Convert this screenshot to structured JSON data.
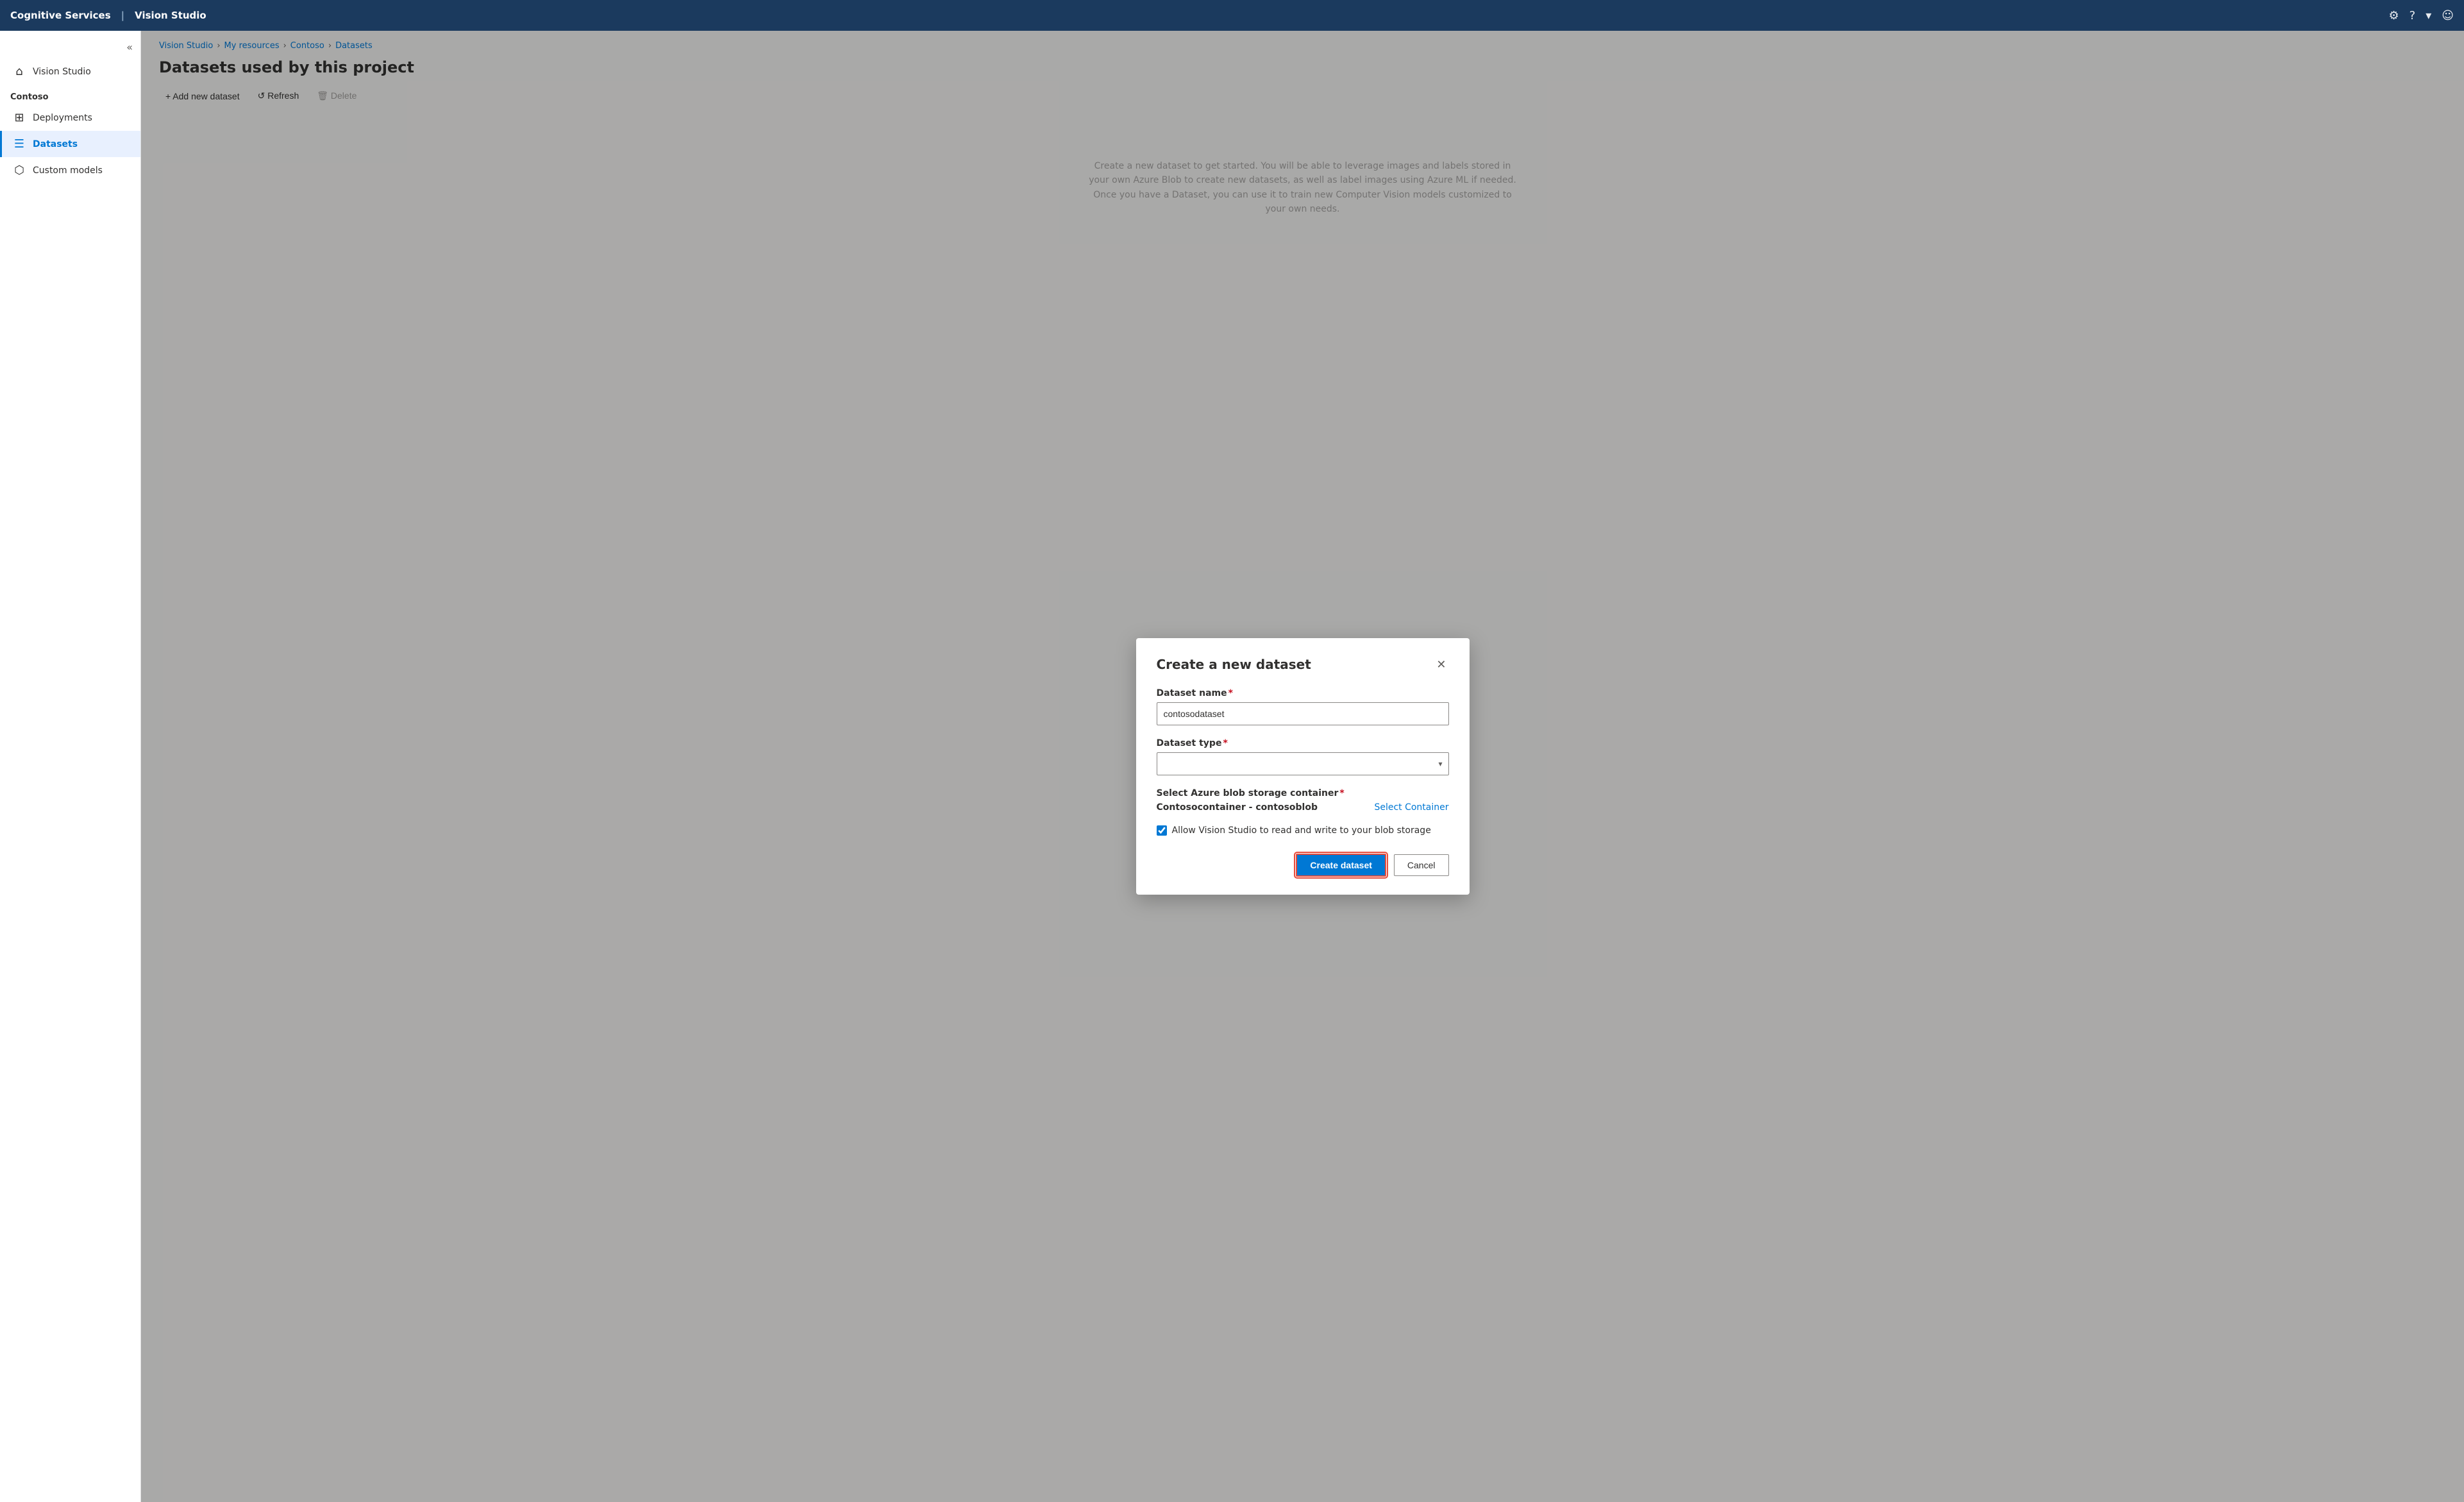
{
  "app": {
    "brand": "Cognitive Services",
    "divider": "|",
    "product": "Vision Studio"
  },
  "nav_icons": {
    "settings": "⚙",
    "help": "?",
    "dropdown": "▾",
    "user": "☺"
  },
  "sidebar": {
    "collapse_icon": "«",
    "section_label": "Contoso",
    "items": [
      {
        "id": "vision-studio",
        "label": "Vision Studio",
        "icon": "⌂",
        "active": false
      },
      {
        "id": "deployments",
        "label": "Deployments",
        "icon": "⊞",
        "active": false
      },
      {
        "id": "datasets",
        "label": "Datasets",
        "icon": "☰",
        "active": true
      },
      {
        "id": "custom-models",
        "label": "Custom models",
        "icon": "⬡",
        "active": false
      }
    ]
  },
  "breadcrumb": {
    "items": [
      {
        "label": "Vision Studio",
        "id": "vision-studio"
      },
      {
        "label": "My resources",
        "id": "my-resources"
      },
      {
        "label": "Contoso",
        "id": "contoso"
      },
      {
        "label": "Datasets",
        "id": "datasets"
      }
    ]
  },
  "page": {
    "title": "Datasets used by this project"
  },
  "toolbar": {
    "add_label": "+ Add new dataset",
    "refresh_label": "↺ Refresh",
    "delete_label": "🗑 Delete"
  },
  "bg_description": "Create a new dataset to get started. You will be able to leverage images and labels stored in your own Azure Blob to create new datasets, as well as label images using Azure ML if needed. Once you have a Dataset, you can use it to train new Computer Vision models customized to your own needs.",
  "modal": {
    "title": "Create a new dataset",
    "fields": {
      "dataset_name": {
        "label": "Dataset name",
        "required": true,
        "value": "contosodataset",
        "placeholder": ""
      },
      "dataset_type": {
        "label": "Dataset type",
        "required": true,
        "value": "",
        "placeholder": "",
        "options": []
      },
      "azure_blob": {
        "label": "Select Azure blob storage container",
        "required": true,
        "container_name": "Contosocontainer - contosoblob",
        "select_link": "Select Container"
      },
      "checkbox": {
        "label": "Allow Vision Studio to read and write to your blob storage",
        "checked": true
      }
    },
    "buttons": {
      "create": "Create dataset",
      "cancel": "Cancel"
    }
  }
}
